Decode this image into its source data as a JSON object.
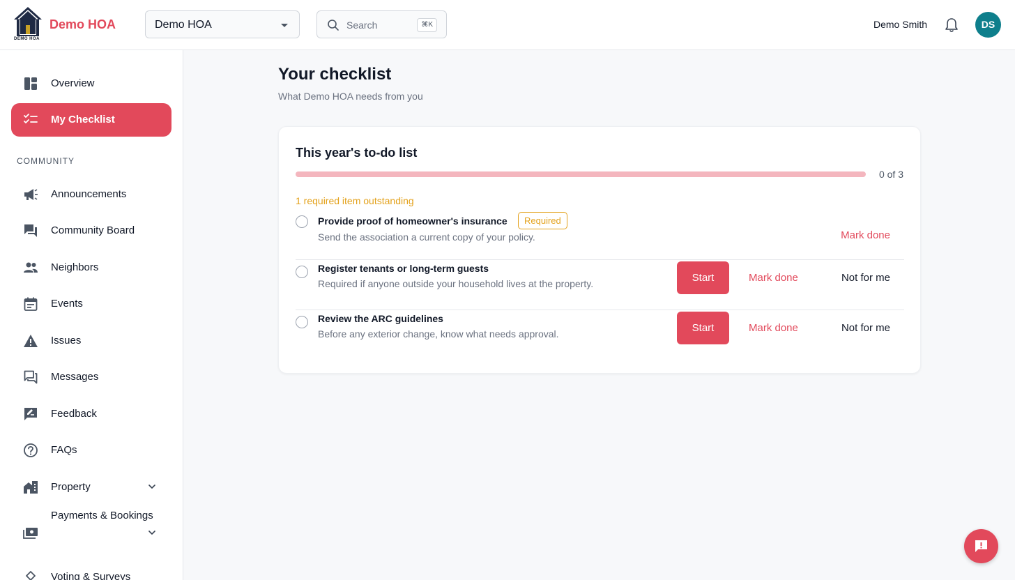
{
  "header": {
    "logo_caption": "DEMO HOA",
    "brand": "Demo HOA",
    "org_select": {
      "value": "Demo HOA"
    },
    "search": {
      "placeholder": "Search",
      "shortcut": "⌘K"
    },
    "user_name": "Demo Smith",
    "avatar_initials": "DS",
    "icons": {
      "search": "search-icon",
      "bell": "bell-icon",
      "caret": "caret-down-icon"
    }
  },
  "sidebar": {
    "top_items": [
      {
        "label": "Overview",
        "icon": "dashboard-icon"
      },
      {
        "label": "My Checklist",
        "icon": "checklist-icon",
        "active": true
      }
    ],
    "section_label": "COMMUNITY",
    "items": [
      {
        "label": "Announcements",
        "icon": "megaphone-icon"
      },
      {
        "label": "Community Board",
        "icon": "forum-icon"
      },
      {
        "label": "Neighbors",
        "icon": "people-icon"
      },
      {
        "label": "Events",
        "icon": "calendar-icon"
      },
      {
        "label": "Issues",
        "icon": "warning-icon"
      },
      {
        "label": "Messages",
        "icon": "messages-icon"
      },
      {
        "label": "Feedback",
        "icon": "feedback-icon"
      },
      {
        "label": "FAQs",
        "icon": "help-icon"
      },
      {
        "label": "Property",
        "icon": "building-icon",
        "expandable": true
      },
      {
        "label": "Payments & Bookings",
        "icon": "payments-icon",
        "expandable": true
      },
      {
        "label": "Voting & Surveys",
        "icon": "voting-icon"
      }
    ]
  },
  "main": {
    "title": "Your checklist",
    "subtitle": "What Demo HOA needs from you",
    "card": {
      "title": "This year's to-do list",
      "progress": {
        "completed": 0,
        "total": 3,
        "text": "0 of 3"
      },
      "outstanding": "1 required item outstanding",
      "items": [
        {
          "title": "Provide proof of homeowner's insurance",
          "badge": "Required",
          "description": "Send the association a current copy of your policy.",
          "mark_done": "Mark done"
        },
        {
          "title": "Register tenants or long-term guests",
          "description": "Required if anyone outside your household lives at the property.",
          "start": "Start",
          "mark_done": "Mark done",
          "not_for_me": "Not for me"
        },
        {
          "title": "Review the ARC guidelines",
          "description": "Before any exterior change, know what needs approval.",
          "start": "Start",
          "mark_done": "Mark done",
          "not_for_me": "Not for me"
        }
      ]
    }
  },
  "colors": {
    "accent": "#e2495b",
    "warning": "#e3a11a",
    "avatar": "#0e7f8c",
    "text": "#111827",
    "muted": "#6b7280"
  },
  "fab": {
    "icon": "feedback-bubble-icon"
  }
}
